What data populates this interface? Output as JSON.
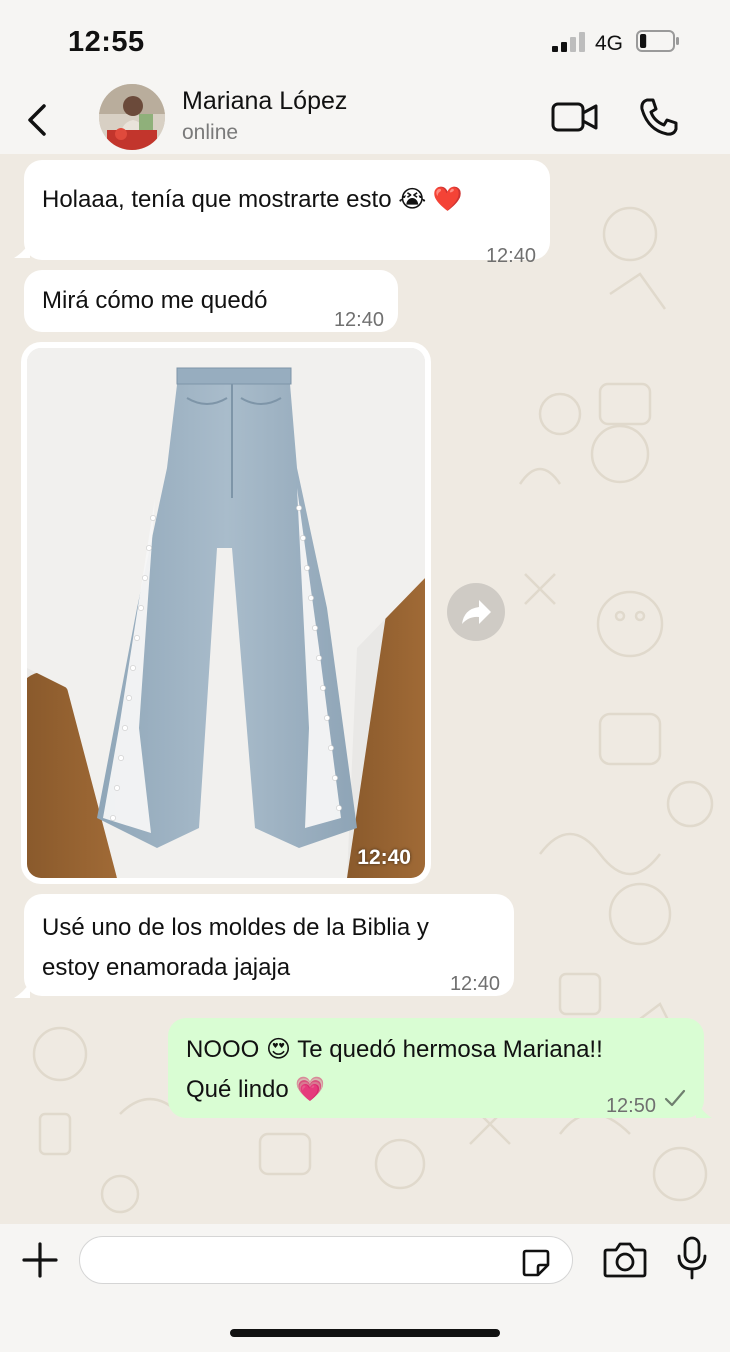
{
  "status_bar": {
    "time": "12:55",
    "network": "4G",
    "battery_level": 0.2
  },
  "header": {
    "contact_name": "Mariana López",
    "contact_status": "online"
  },
  "messages": [
    {
      "direction": "in",
      "text": "Holaaa, tenía que mostrarte esto 😭 ❤️",
      "time": "12:40"
    },
    {
      "direction": "in",
      "text": "Mirá cómo me quedó",
      "time": "12:40"
    },
    {
      "direction": "in",
      "type": "image",
      "image_description": "light-wash flared jeans with lace and pearl side panels",
      "time": "12:40"
    },
    {
      "direction": "in",
      "text_line1": "Usé uno de los moldes de la Biblia y",
      "text_line2": "estoy enamorada jajaja",
      "time": "12:40"
    },
    {
      "direction": "out",
      "text_line1": "NOOO 😍 Te quedó hermosa Mariana!!",
      "text_line2": "Qué lindo 💗",
      "time": "12:50",
      "status": "sent"
    }
  ],
  "composer": {
    "placeholder": ""
  },
  "icons": {
    "back": "chevron-left-icon",
    "video": "video-camera-icon",
    "call": "phone-icon",
    "forward": "forward-arrow-icon",
    "plus": "plus-icon",
    "sticker": "sticker-icon",
    "camera": "camera-icon",
    "mic": "microphone-icon",
    "check": "single-check-icon"
  },
  "colors": {
    "incoming_bubble": "#ffffff",
    "outgoing_bubble": "#d9fdd3",
    "chat_background": "#efeae2"
  }
}
